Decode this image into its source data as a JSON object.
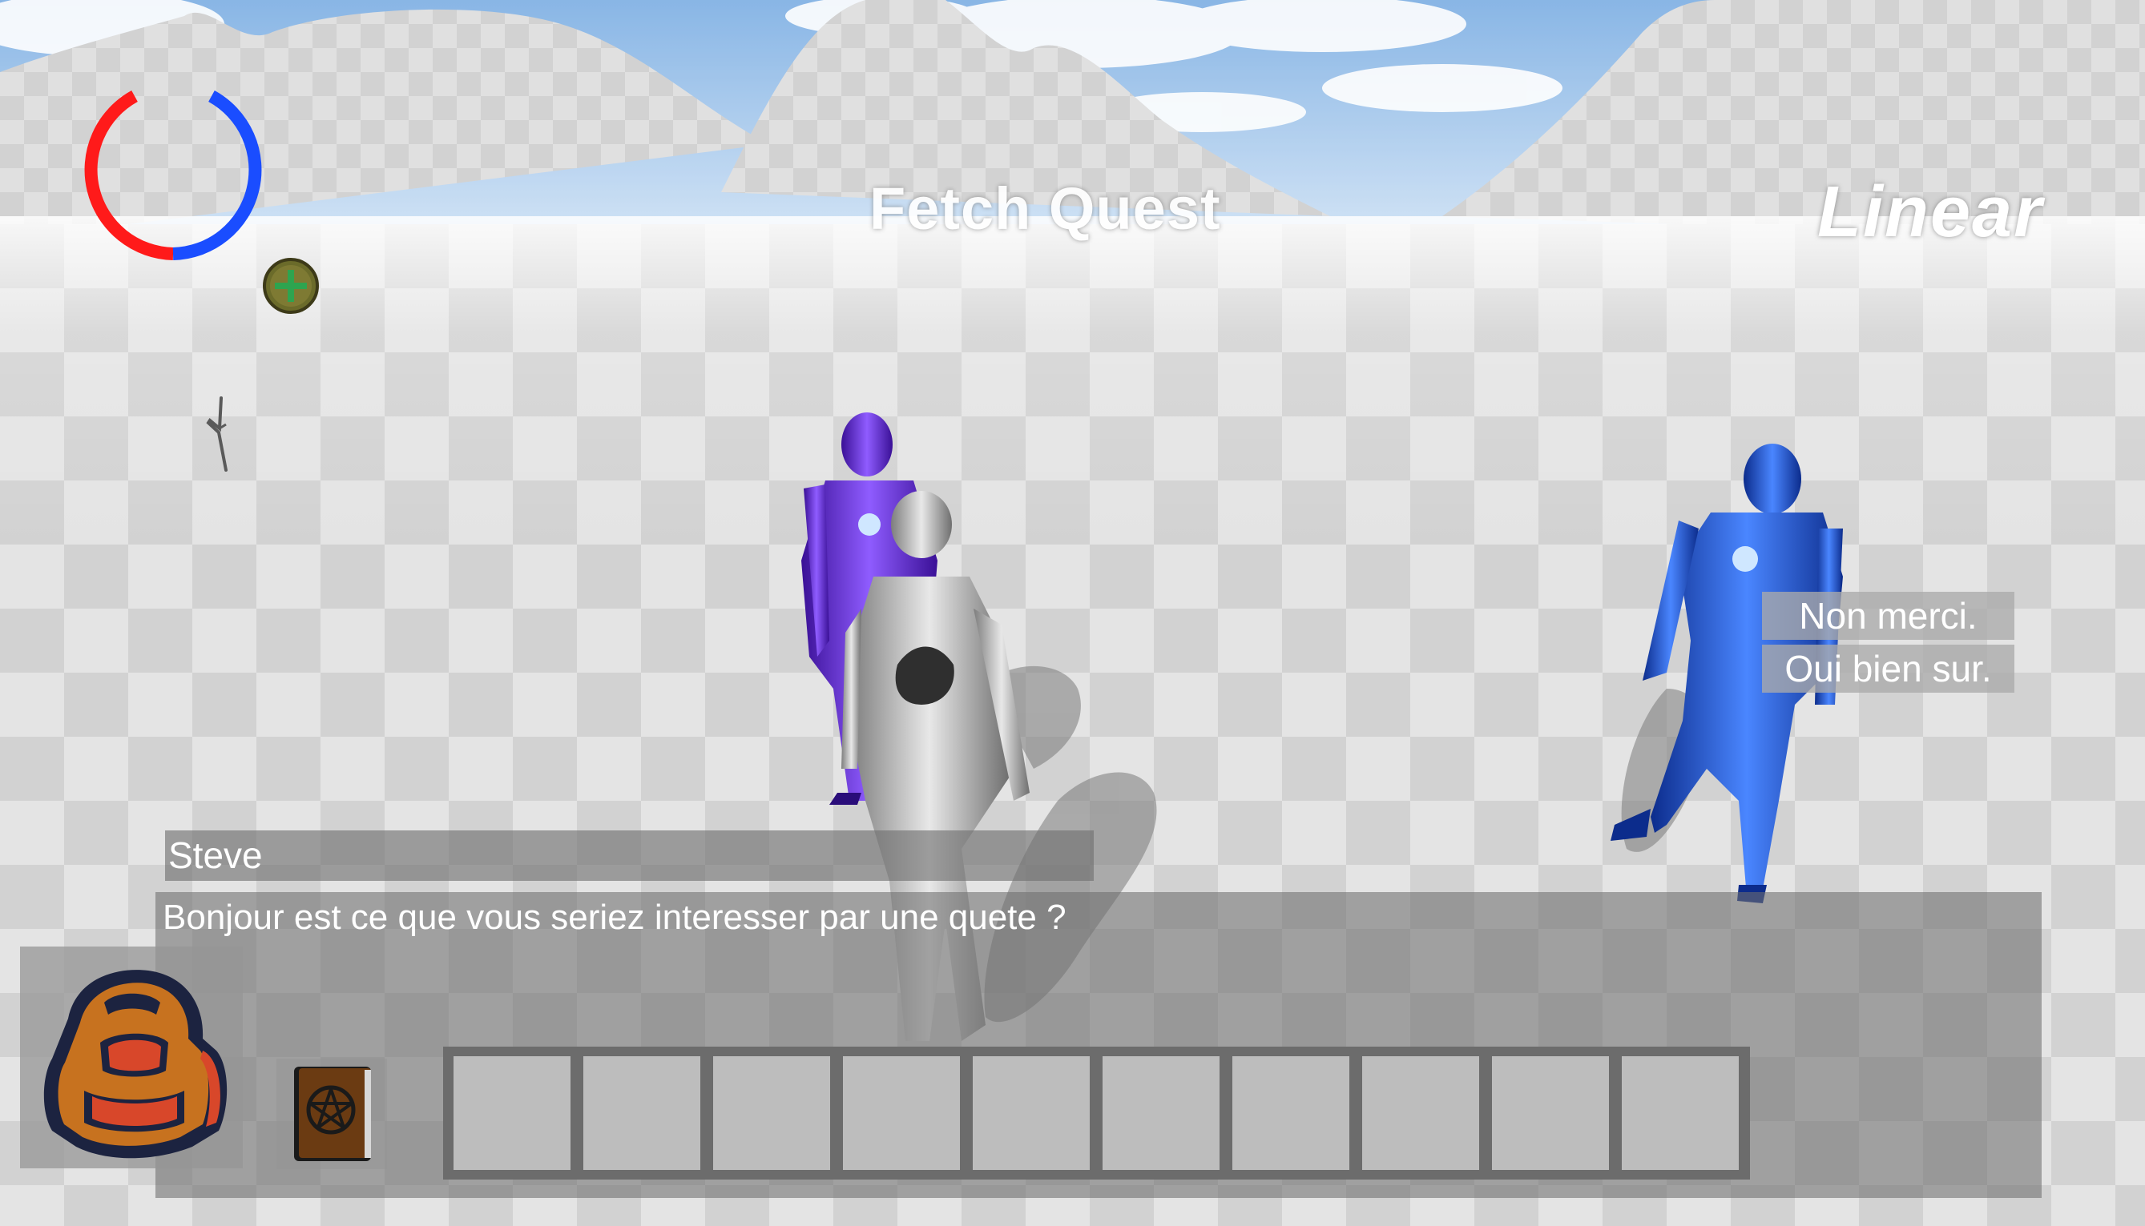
{
  "world_labels": {
    "fetch_quest": "Fetch Quest",
    "linear": "Linear"
  },
  "dialog": {
    "speaker": "Steve",
    "text": "Bonjour est ce que vous seriez interesser par une quete ?",
    "choices": [
      {
        "label": "Non merci."
      },
      {
        "label": "Oui bien sur."
      }
    ]
  },
  "hud": {
    "health_ring_icon": "circular-health-ring",
    "health_ring_colors": {
      "left": "#ff1a1a",
      "right": "#1a4dff"
    },
    "add_icon": "plus-circle-icon",
    "stick_icon": "stick-icon"
  },
  "inventory": {
    "backpack_icon": "backpack-icon",
    "book_icon": "spellbook-icon",
    "hotbar_slots": 10
  },
  "colors": {
    "sky": "#8fbde8",
    "ground_light": "#e6e6e6",
    "ground_dark": "#cfcfcf",
    "purple_character": "#6a2ee0",
    "blue_character": "#1d4fe0",
    "silver_character": "#b8b8b8"
  }
}
